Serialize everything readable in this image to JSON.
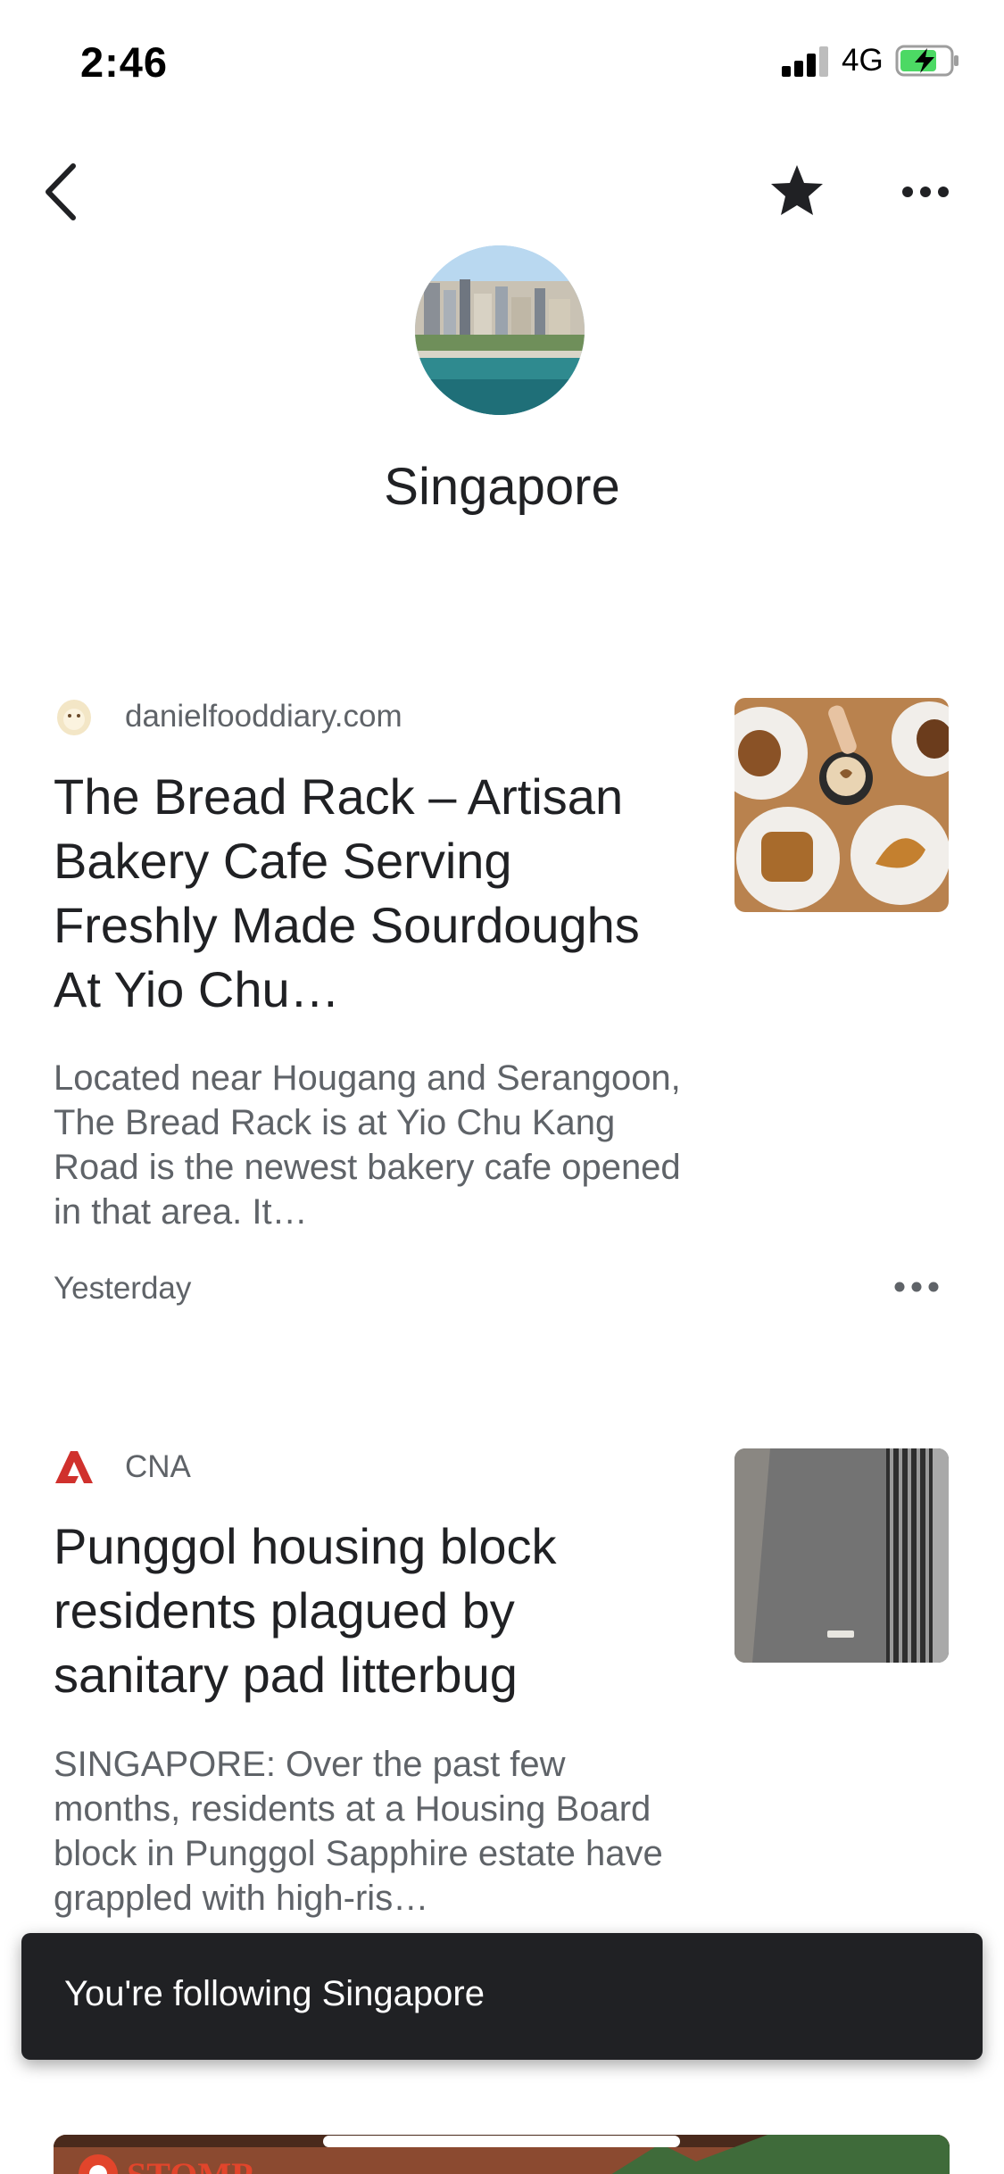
{
  "status_bar": {
    "time": "2:46",
    "network": "4G"
  },
  "topic": {
    "title": "Singapore"
  },
  "articles": [
    {
      "source": "danielfooddiary.com",
      "headline": "The Bread Rack – Artisan Bakery Cafe Serving Freshly Made Sourdoughs At Yio Chu…",
      "snippet": "Located near Hougang and Serangoon, The Bread Rack is at Yio Chu Kang Road is the newest bakery cafe opened in that area. It…",
      "time": "Yesterday"
    },
    {
      "source": "CNA",
      "headline": "Punggol housing block residents plagued by sanitary pad litterbug",
      "snippet": "SINGAPORE: Over the past few months, residents at a Housing Board block in Punggol Sapphire estate have grappled with high-ris…"
    }
  ],
  "snackbar": {
    "message": "You're following Singapore"
  },
  "next_card": {
    "logo_text": "STOMP"
  },
  "icons": {
    "back": "back-arrow-icon",
    "star": "star-icon",
    "more": "more-horizontal-icon"
  },
  "colors": {
    "text_primary": "#202124",
    "text_secondary": "#5f6368",
    "snackbar_bg": "#202124",
    "battery_charging": "#4cd964",
    "cna_red": "#d0312d"
  }
}
